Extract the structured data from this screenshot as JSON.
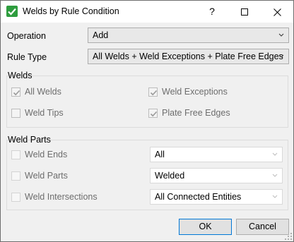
{
  "window": {
    "title": "Welds by Rule Condition",
    "controls": {
      "help": "?",
      "maximize": "☐",
      "close": "✕"
    }
  },
  "form": {
    "operation_label": "Operation",
    "operation_value": "Add",
    "rule_type_label": "Rule Type",
    "rule_type_value": "All Welds + Weld Exceptions + Plate Free Edges"
  },
  "welds_group": {
    "title": "Welds",
    "items": [
      {
        "label": "All Welds",
        "checked": true
      },
      {
        "label": "Weld Exceptions",
        "checked": true
      },
      {
        "label": "Weld Tips",
        "checked": false
      },
      {
        "label": "Plate Free Edges",
        "checked": true
      }
    ]
  },
  "weld_parts_group": {
    "title": "Weld Parts",
    "rows": [
      {
        "label": "Weld Ends",
        "checked": false,
        "value": "All"
      },
      {
        "label": "Weld Parts",
        "checked": false,
        "value": "Welded"
      },
      {
        "label": "Weld Intersections",
        "checked": false,
        "value": "All Connected Entities"
      }
    ]
  },
  "buttons": {
    "ok": "OK",
    "cancel": "Cancel"
  },
  "colors": {
    "accent": "#0078d7",
    "icon_green": "#2e9d3e"
  }
}
